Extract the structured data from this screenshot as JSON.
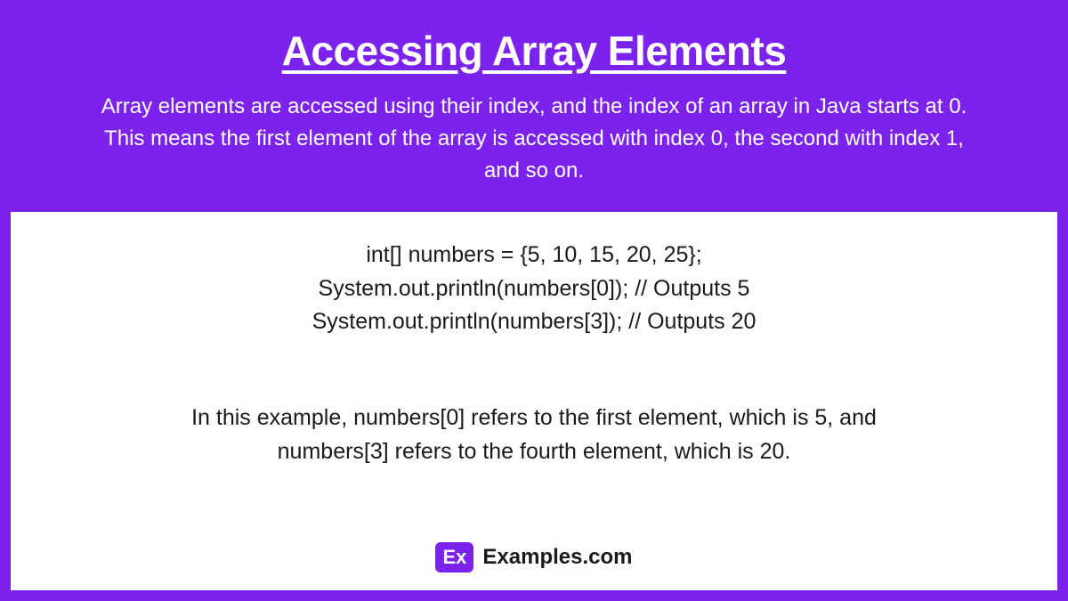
{
  "header": {
    "title": "Accessing Array Elements",
    "description": "Array elements are accessed using their index, and the index of an array in Java starts at 0. This means the first element of the array is accessed with index 0, the second with index 1, and so on."
  },
  "code": {
    "line1": "int[] numbers = {5, 10, 15, 20, 25};",
    "line2": "System.out.println(numbers[0]); // Outputs 5",
    "line3": "System.out.println(numbers[3]); // Outputs 20"
  },
  "explanation": "In this example, numbers[0] refers to the first element, which is 5, and numbers[3] refers to the fourth element, which is 20.",
  "footer": {
    "logo_abbr": "Ex",
    "logo_text": "Examples.com"
  }
}
